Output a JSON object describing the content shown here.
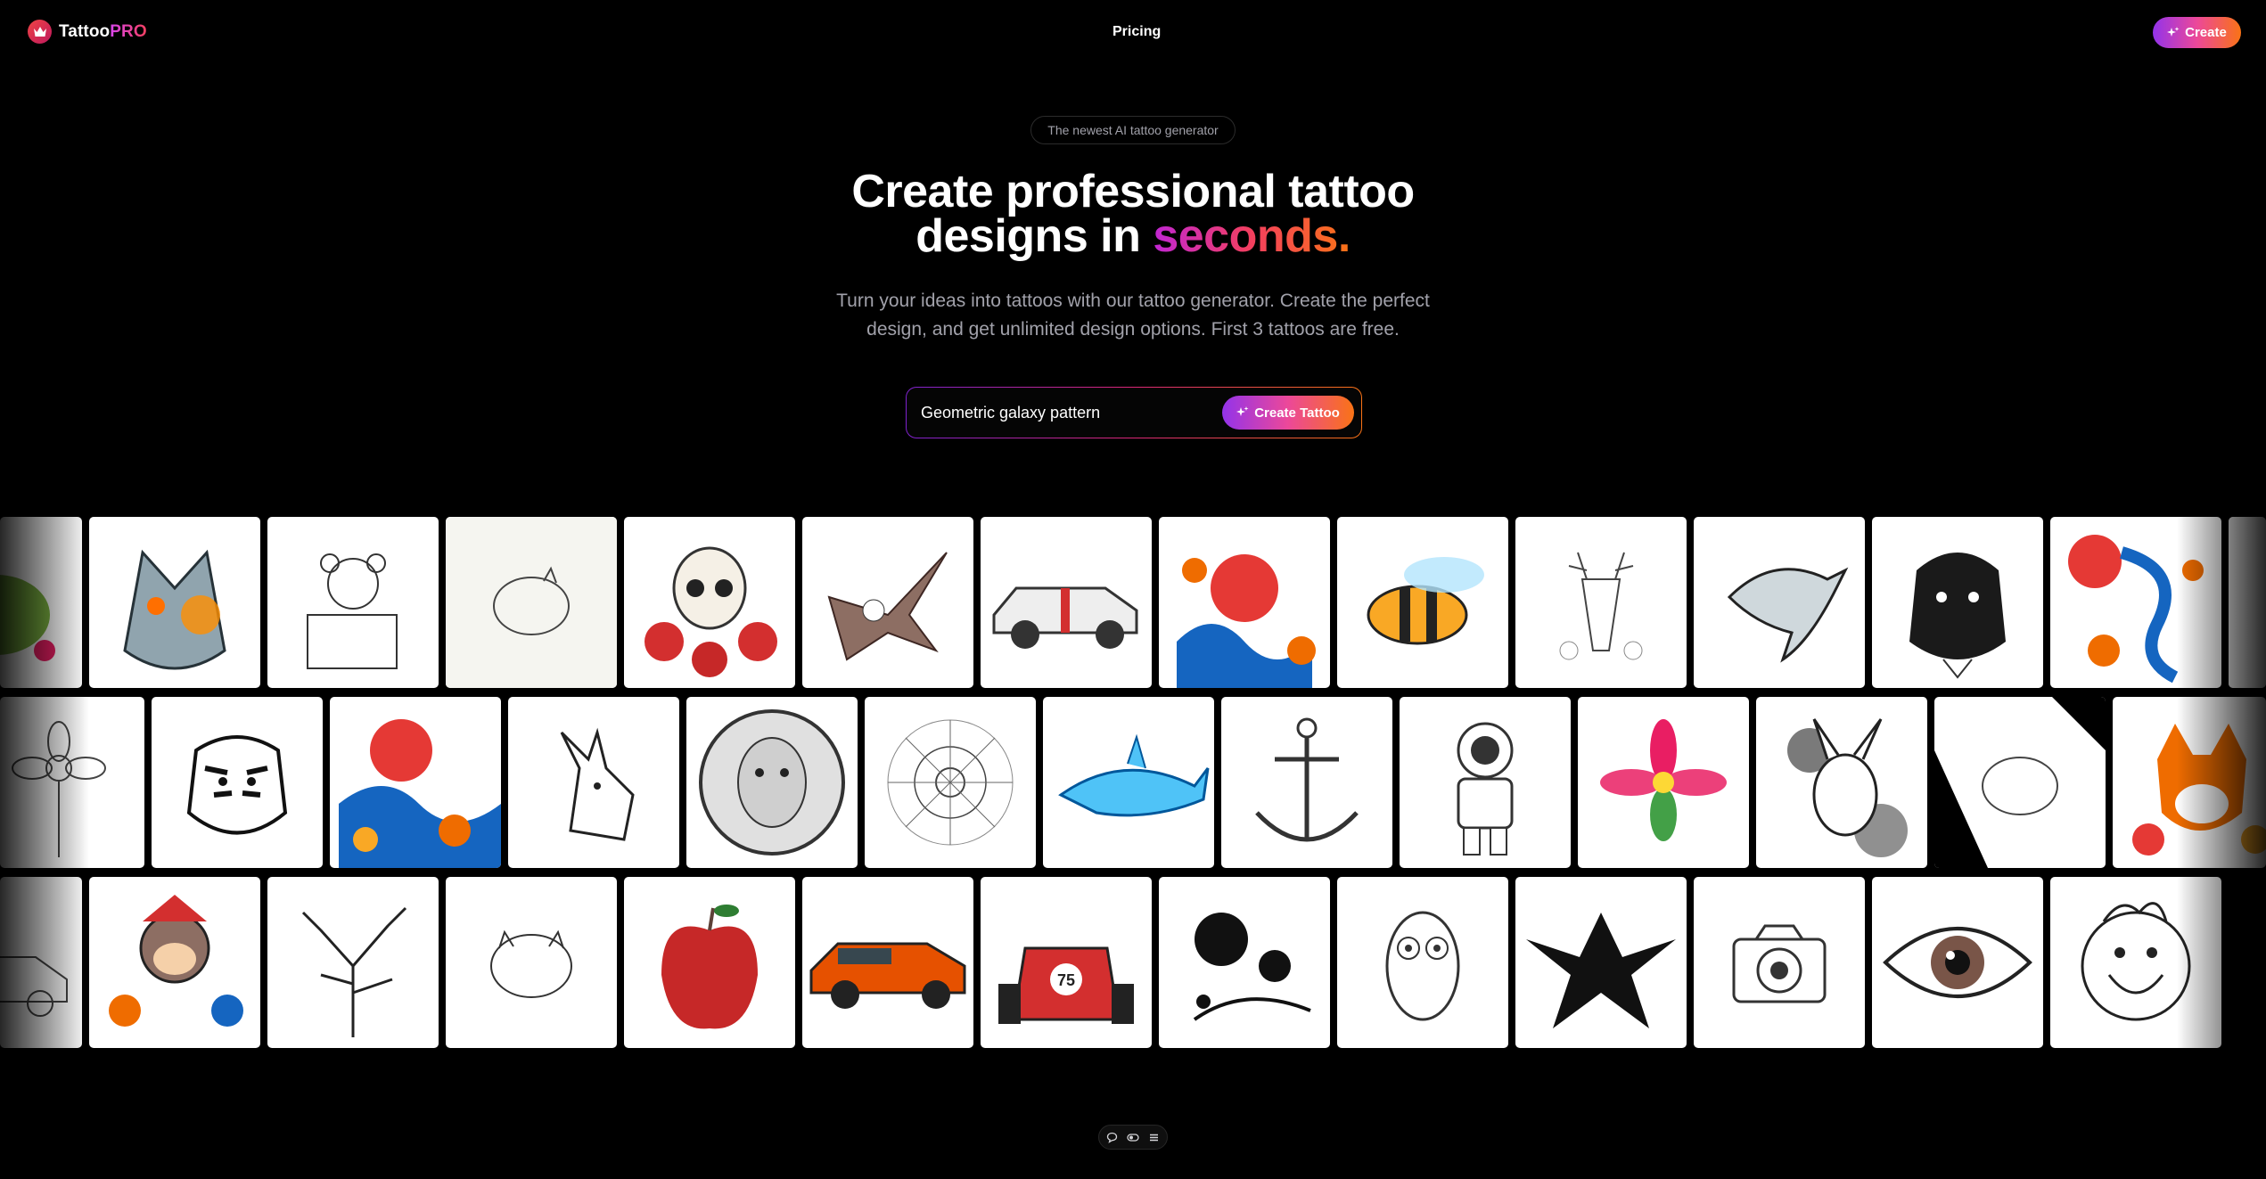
{
  "header": {
    "brand_name": "Tattoo",
    "brand_suffix": "PRO",
    "nav_pricing": "Pricing",
    "create_label": "Create"
  },
  "hero": {
    "badge": "The newest AI tattoo generator",
    "headline_line1": "Create professional tattoo",
    "headline_line2_prefix": "designs in ",
    "headline_accent": "seconds.",
    "subtitle_line1": "Turn your ideas into tattoos with our tattoo generator. Create the perfect",
    "subtitle_line2": "design, and get unlimited design options. First 3 tattoos are free."
  },
  "search": {
    "value": "Geometric galaxy pattern",
    "button_label": "Create Tattoo"
  },
  "gallery": {
    "rows": [
      [
        "frog",
        "robot-wolf",
        "teddy-bear-in-box",
        "sleeping-cat-sketch",
        "skull-with-roses",
        "eagle",
        "classic-muscle-car",
        "japanese-sun-waves",
        "bee",
        "deer-head",
        "dolphin",
        "dog-portrait",
        "dragon-sun",
        "partial"
      ],
      [
        "flower-sketch",
        "tiger",
        "japanese-wave-koi",
        "dog-profile",
        "astronaut-woman",
        "mandala-flower",
        "shark",
        "anchor",
        "robot-astronaut",
        "watercolor-flower",
        "pikachu-splash",
        "sleeping-cat",
        "shiba-inu"
      ],
      [
        "car-sketch",
        "monkey-traditional",
        "bare-tree",
        "curled-cat",
        "red-apple",
        "orange-mustang",
        "race-car-75",
        "ink-splatter-branch",
        "owl",
        "phoenix-tribal",
        "camera-ornate",
        "realistic-eye",
        "smiling-face"
      ]
    ]
  },
  "colors": {
    "background": "#000000",
    "accent_gradient_start": "#9333ea",
    "accent_gradient_mid": "#ec4899",
    "accent_gradient_end": "#f97316"
  },
  "toolbar": {
    "icons": [
      "chat-icon",
      "toggle-icon",
      "menu-icon"
    ]
  }
}
